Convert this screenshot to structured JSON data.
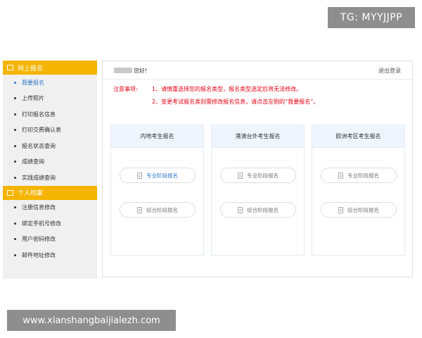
{
  "watermarks": {
    "top": "TG: MYYJJPP",
    "bottom": "www.xianshangbaijialezh.com"
  },
  "sidebar": {
    "sections": [
      {
        "title": "网上报名",
        "items": [
          {
            "label": "我要报名",
            "active": true
          },
          {
            "label": "上传照片"
          },
          {
            "label": "打印报名信息"
          },
          {
            "label": "打印交费确认表"
          },
          {
            "label": "报名状态查询"
          },
          {
            "label": "成绩查询"
          },
          {
            "label": "实践成绩查询"
          }
        ]
      },
      {
        "title": "个人档案",
        "items": [
          {
            "label": "注册信息修改"
          },
          {
            "label": "绑定手机号修改"
          },
          {
            "label": "用户密码修改"
          },
          {
            "label": "邮件地址修改"
          }
        ]
      }
    ]
  },
  "header": {
    "greeting": "您好!",
    "logout": "退出登录"
  },
  "notice": {
    "label": "注意事项:",
    "line1": "1、请慎重选择您的报名类型，报名类型选定后将无法修改。",
    "line2": "2、变更考试报名类别需修改报名信息，请点击左侧的“我要报名”。"
  },
  "cards": [
    {
      "title": "内地考生报名",
      "btn1": "专业阶段报名",
      "btn2": "综合阶段报名"
    },
    {
      "title": "港澳台外考生报名",
      "btn1": "专业阶段报名",
      "btn2": "综合阶段报名"
    },
    {
      "title": "欧洲考区考生报名",
      "btn1": "专业阶段报名",
      "btn2": "综合阶段报名"
    }
  ],
  "colors": {
    "accent": "#f4b400",
    "notice": "#e60012",
    "link": "#2f78c4"
  }
}
